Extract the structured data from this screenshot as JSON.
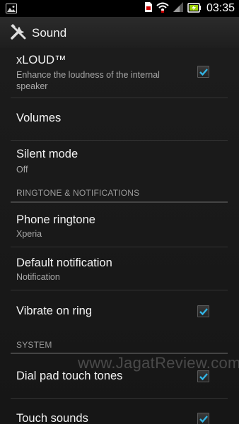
{
  "status_bar": {
    "time": "03:35",
    "icons": [
      "gallery-notification-icon",
      "sim-card-icon",
      "wifi-icon",
      "signal-icon",
      "battery-charging-icon"
    ]
  },
  "action_bar": {
    "title": "Sound",
    "icon": "tools-icon"
  },
  "items": [
    {
      "title": "xLOUD™",
      "subtitle": "Enhance the loudness of the internal speaker",
      "checked": true
    },
    {
      "title": "Volumes"
    },
    {
      "title": "Silent mode",
      "subtitle": "Off"
    },
    {
      "title": "Phone ringtone",
      "subtitle": "Xperia"
    },
    {
      "title": "Default notification",
      "subtitle": "Notification"
    },
    {
      "title": "Vibrate on ring",
      "checked": true
    },
    {
      "title": "Dial pad touch tones",
      "checked": true
    },
    {
      "title": "Touch sounds",
      "checked": true
    }
  ],
  "sections": {
    "ringtone": "RINGTONE & NOTIFICATIONS",
    "system": "SYSTEM"
  },
  "watermark": "www.JagatReview.com",
  "colors": {
    "accent": "#33b5e5",
    "background": "#161616"
  }
}
